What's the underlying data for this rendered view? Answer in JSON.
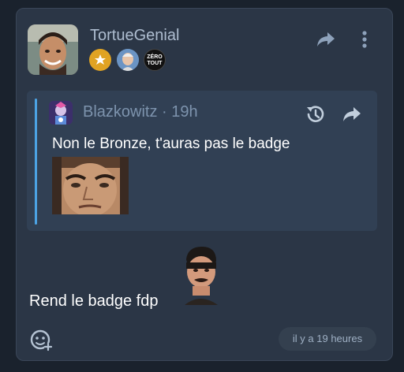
{
  "post": {
    "author": "TortueGenial",
    "badges": [
      {
        "icon": "star-badge-icon",
        "color": "#e0a323"
      },
      {
        "icon": "portrait-badge-icon",
        "color": "#6b94c4"
      },
      {
        "icon": "zero-tout-badge-icon",
        "label": "ZÉRO TOUT",
        "color": "#111111"
      }
    ],
    "message": "Rend le badge fdp",
    "timestamp": "il y a 19 heures"
  },
  "quote": {
    "author": "Blazkowitz",
    "separator": "·",
    "time": "19h",
    "text": "Non le Bronze, t'auras pas le badge",
    "accent_color": "#4ca3e4"
  },
  "icons": {
    "share": "share-arrow-icon",
    "more": "more-vertical-icon",
    "history": "history-icon",
    "add_reaction": "add-reaction-icon"
  }
}
